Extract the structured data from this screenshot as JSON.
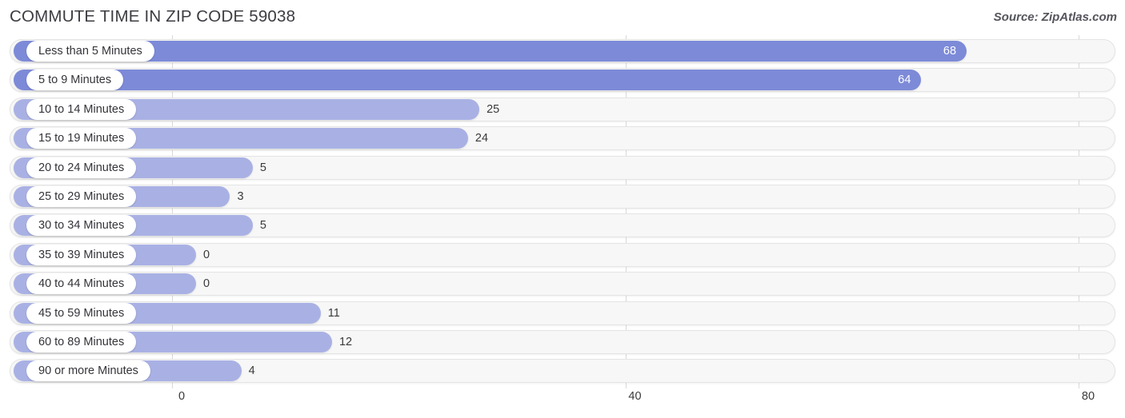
{
  "header": {
    "title": "COMMUTE TIME IN ZIP CODE 59038",
    "source": "Source: ZipAtlas.com"
  },
  "colors": {
    "bar_strong": "#7d8ad8",
    "bar_light": "#a9b1e4",
    "track": "#f7f7f7",
    "track_border": "#e4e4e4",
    "gridline": "#d9d9d9",
    "text": "#3a3a3a"
  },
  "chart_data": {
    "type": "bar",
    "orientation": "horizontal",
    "title": "COMMUTE TIME IN ZIP CODE 59038",
    "xlabel": "",
    "ylabel": "",
    "xlim": [
      0,
      80
    ],
    "grid": true,
    "legend": "none",
    "xticks": [
      "0",
      "40",
      "80"
    ],
    "xtick_values": [
      0,
      40,
      80
    ],
    "categories": [
      "Less than 5 Minutes",
      "5 to 9 Minutes",
      "10 to 14 Minutes",
      "15 to 19 Minutes",
      "20 to 24 Minutes",
      "25 to 29 Minutes",
      "30 to 34 Minutes",
      "35 to 39 Minutes",
      "40 to 44 Minutes",
      "45 to 59 Minutes",
      "60 to 89 Minutes",
      "90 or more Minutes"
    ],
    "values": [
      68,
      64,
      25,
      24,
      5,
      3,
      5,
      0,
      0,
      11,
      12,
      4
    ],
    "value_labels": [
      "68",
      "64",
      "25",
      "24",
      "5",
      "3",
      "5",
      "0",
      "0",
      "11",
      "12",
      "4"
    ]
  },
  "rows": [
    {
      "label": "Less than 5 Minutes",
      "value": 68,
      "value_label": "68",
      "inside": true,
      "strong": true
    },
    {
      "label": "5 to 9 Minutes",
      "value": 64,
      "value_label": "64",
      "inside": true,
      "strong": true
    },
    {
      "label": "10 to 14 Minutes",
      "value": 25,
      "value_label": "25",
      "inside": false,
      "strong": false
    },
    {
      "label": "15 to 19 Minutes",
      "value": 24,
      "value_label": "24",
      "inside": false,
      "strong": false
    },
    {
      "label": "20 to 24 Minutes",
      "value": 5,
      "value_label": "5",
      "inside": false,
      "strong": false
    },
    {
      "label": "25 to 29 Minutes",
      "value": 3,
      "value_label": "3",
      "inside": false,
      "strong": false
    },
    {
      "label": "30 to 34 Minutes",
      "value": 5,
      "value_label": "5",
      "inside": false,
      "strong": false
    },
    {
      "label": "35 to 39 Minutes",
      "value": 0,
      "value_label": "0",
      "inside": false,
      "strong": false
    },
    {
      "label": "40 to 44 Minutes",
      "value": 0,
      "value_label": "0",
      "inside": false,
      "strong": false
    },
    {
      "label": "45 to 59 Minutes",
      "value": 11,
      "value_label": "11",
      "inside": false,
      "strong": false
    },
    {
      "label": "60 to 89 Minutes",
      "value": 12,
      "value_label": "12",
      "inside": false,
      "strong": false
    },
    {
      "label": "90 or more Minutes",
      "value": 4,
      "value_label": "4",
      "inside": false,
      "strong": false
    }
  ]
}
